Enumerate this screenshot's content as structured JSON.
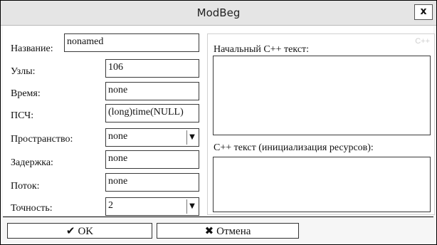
{
  "window": {
    "title": "ModBeg",
    "close_label": "x"
  },
  "fields": [
    {
      "label": "Название:",
      "value": "nonamed",
      "type": "edit"
    },
    {
      "label": "Узлы:",
      "value": "106",
      "type": "edit"
    },
    {
      "label": "Время:",
      "value": "none",
      "type": "edit"
    },
    {
      "label": "ПСЧ:",
      "value": "(long)time(NULL)",
      "type": "edit"
    },
    {
      "label": "Пространство:",
      "value": "none",
      "type": "combo"
    },
    {
      "label": "Задержка:",
      "value": "none",
      "type": "edit"
    },
    {
      "label": "Поток:",
      "value": "none",
      "type": "edit"
    },
    {
      "label": "Точность:",
      "value": "2",
      "type": "combo"
    }
  ],
  "code_panel": {
    "watermark": "C++",
    "initial_label": "Начальный C++ текст:",
    "init_label": "C++ текст (инициализация ресурсов):"
  },
  "buttons": {
    "ok": "OK",
    "cancel": "Отмена"
  },
  "icons": {
    "ok": "check-icon",
    "cancel": "x-icon",
    "combo": "chevron-down-icon"
  }
}
